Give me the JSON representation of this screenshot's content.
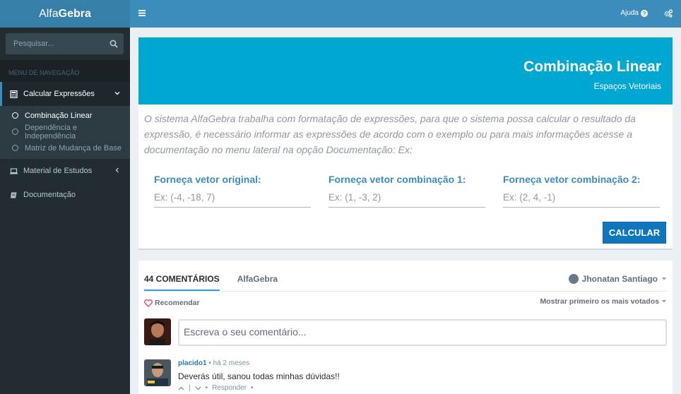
{
  "brand": {
    "light": "Alfa",
    "bold": "Gebra"
  },
  "search": {
    "placeholder": "Pesquisar..."
  },
  "sidebar": {
    "header": "MENU DE NAVEGAÇÃO",
    "items": [
      {
        "label": "Calcular Expressões",
        "icon": "calculator-icon",
        "expanded": true
      },
      {
        "label": "Material de Estudos",
        "icon": "laptop-icon"
      },
      {
        "label": "Documentação",
        "icon": "book-icon"
      }
    ],
    "subitems": [
      {
        "label": "Combinação Linear",
        "active": true
      },
      {
        "label": "Dependência e Independência"
      },
      {
        "label": "Matriz de Mudança de Base"
      }
    ]
  },
  "topbar": {
    "help": "Ajuda"
  },
  "hero": {
    "title": "Combinação Linear",
    "subtitle": "Espaços Vetoriais"
  },
  "form": {
    "intro": "O sistema AlfaGebra trabalha com formatação de expressões, para que o sistema possa calcular o resultado da expressão, é necessário informar as expressões de acordo com o exemplo ou para mais informações acesse a documentação no menu lateral na opção Documentação: Ex:",
    "fields": [
      {
        "label": "Forneça vetor original:",
        "placeholder": "Ex: (-4, -18, 7)"
      },
      {
        "label": "Forneça vetor combinação 1:",
        "placeholder": "Ex: (1, -3, 2)"
      },
      {
        "label": "Forneça vetor combinação 2:",
        "placeholder": "Ex: (2, 4, -1)"
      }
    ],
    "button": "CALCULAR"
  },
  "comments": {
    "tab_count": "44 COMENTÁRIOS",
    "tab_site": "AlfaGebra",
    "user": "Jhonatan Santiago",
    "recommend": "Recomendar",
    "sort": "Mostrar primeiro os mais votados",
    "compose_placeholder": "Escreva o seu comentário...",
    "first": {
      "author": "placido1",
      "ago": "há 2 meses",
      "text": "Deverás útil, sanou todas minhas dúvidas!!",
      "reply": "Responder"
    }
  },
  "colors": {
    "topbar": "#3c8dbc",
    "sidebar": "#222d32",
    "hero": "#00a7d0",
    "button": "#0f76bc"
  }
}
